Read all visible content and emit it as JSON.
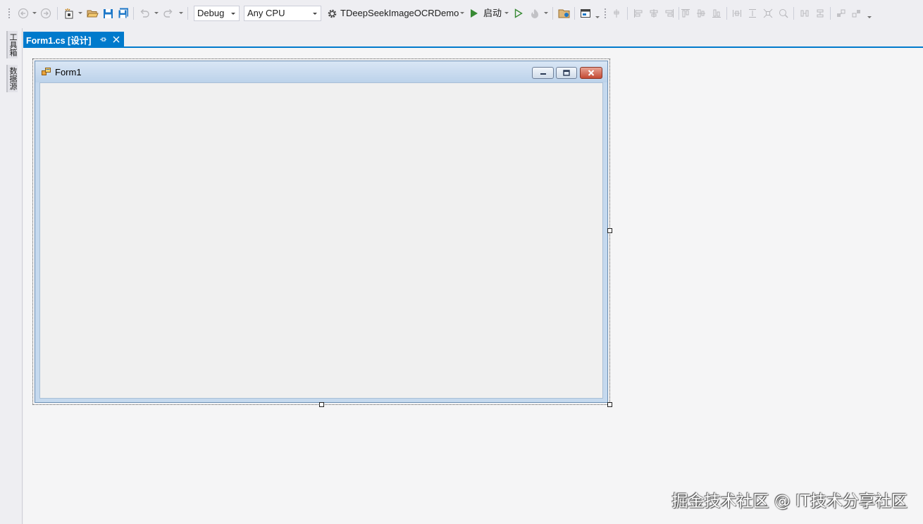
{
  "toolbar": {
    "config_value": "Debug",
    "platform_value": "Any CPU",
    "startup_project": "TDeepSeekImageOCRDemo",
    "start_label": "启动",
    "icons": [
      "back-icon",
      "forward-icon",
      "new-project-icon",
      "open-file-icon",
      "save-icon",
      "save-all-icon",
      "undo-icon",
      "redo-icon",
      "gear-icon",
      "start-icon",
      "start-without-debug-icon",
      "hot-reload-icon",
      "open-folder-icon",
      "tab-order-icon",
      "align-left-icon",
      "align-center-icon",
      "align-right-icon",
      "align-top-icon",
      "align-middle-icon",
      "align-bottom-icon",
      "make-same-width-icon",
      "make-same-height-icon",
      "make-same-size-icon",
      "size-to-grid-icon",
      "center-horizontally-icon",
      "center-vertically-icon",
      "bring-to-front-icon",
      "send-to-back-icon"
    ]
  },
  "sidebar": {
    "items": [
      {
        "label": "工具箱"
      },
      {
        "label": "数据源"
      }
    ]
  },
  "document_tab": {
    "title": "Form1.cs [设计]"
  },
  "form": {
    "caption": "Form1"
  },
  "watermark": "掘金技术社区 @ IT技术分享社区",
  "colors": {
    "accent": "#007acc",
    "designer_bg": "#f5f5f6",
    "form_client": "#f0f0f0",
    "form_border": "#c5d9ee"
  }
}
